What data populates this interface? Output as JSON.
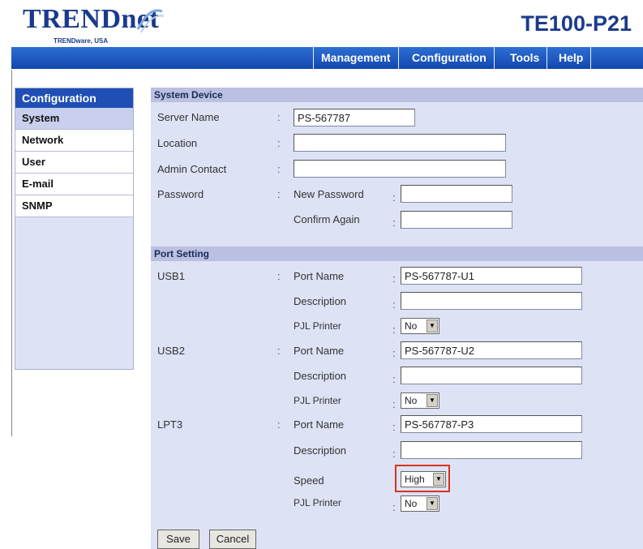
{
  "brand": {
    "logo_text": "TRENDnet",
    "logo_sub": "TRENDware, USA",
    "model": "TE100-P21"
  },
  "nav": {
    "items": [
      "Management",
      "Configuration",
      "Tools",
      "Help"
    ]
  },
  "sidebar": {
    "title": "Configuration",
    "items": [
      "System",
      "Network",
      "User",
      "E-mail",
      "SNMP"
    ],
    "active": "System"
  },
  "system_device": {
    "heading": "System Device",
    "server_name_label": "Server Name",
    "server_name_value": "PS-567787",
    "location_label": "Location",
    "location_value": "",
    "admin_contact_label": "Admin Contact",
    "admin_contact_value": "",
    "password_label": "Password",
    "new_password_label": "New Password",
    "confirm_again_label": "Confirm Again"
  },
  "port_setting": {
    "heading": "Port Setting",
    "ports": [
      {
        "name": "USB1",
        "port_name_label": "Port Name",
        "port_name_value": "PS-567787-U1",
        "description_label": "Description",
        "description_value": "",
        "pjl_label": "PJL Printer",
        "pjl_value": "No"
      },
      {
        "name": "USB2",
        "port_name_label": "Port Name",
        "port_name_value": "PS-567787-U2",
        "description_label": "Description",
        "description_value": "",
        "pjl_label": "PJL Printer",
        "pjl_value": "No"
      },
      {
        "name": "LPT3",
        "port_name_label": "Port Name",
        "port_name_value": "PS-567787-P3",
        "description_label": "Description",
        "description_value": "",
        "speed_label": "Speed",
        "speed_value": "High",
        "pjl_label": "PJL Printer",
        "pjl_value": "No"
      }
    ]
  },
  "actions": {
    "save": "Save",
    "cancel": "Cancel"
  },
  "colors": {
    "brand_blue": "#1a3a8c",
    "nav_blue": "#1f4fb5",
    "panel_bg": "#dde2f5",
    "highlight": "#d7341c"
  }
}
